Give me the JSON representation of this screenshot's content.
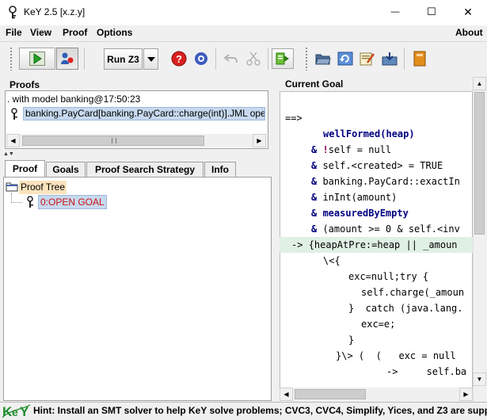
{
  "window": {
    "title": "KeY 2.5 [x.z.y]",
    "minimize_symbol": "—",
    "maximize_symbol": "☐",
    "close_symbol": "✕"
  },
  "menu": {
    "items": [
      "File",
      "View",
      "Proof",
      "Options"
    ],
    "right_item": "About"
  },
  "toolbar": {
    "run_label": "Run Z3",
    "icons": [
      "auto-mode-start-icon",
      "user-interaction-icon",
      "run-z3-button",
      "dropdown-arrow-icon",
      "stop-icon",
      "settings-icon",
      "undo-icon",
      "prune-icon",
      "goal-back-icon",
      "open-folder-icon",
      "reload-icon",
      "edit-icon",
      "save-icon",
      "book-icon"
    ]
  },
  "proofs": {
    "title": "Proofs",
    "env_line": ". with model banking@17:50:23",
    "proof_item": "banking.PayCard[banking.PayCard::charge(int)].JML ope"
  },
  "tabs": [
    "Proof",
    "Goals",
    "Proof Search Strategy",
    "Info"
  ],
  "tree": {
    "root": "Proof Tree",
    "node": "0:OPEN GOAL"
  },
  "goal": {
    "title": "Current Goal",
    "lines": [
      {
        "prefix": "==>",
        "kw": "",
        "body": ""
      },
      {
        "prefix": "",
        "kw": "",
        "body": "wellFormed(heap)"
      },
      {
        "prefix": "& ",
        "kw": "!",
        "body": "self = null"
      },
      {
        "prefix": "& ",
        "kw": "",
        "body": "self.<created> = TRUE"
      },
      {
        "prefix": "& ",
        "kw": "",
        "body": "banking.PayCard::exactIn"
      },
      {
        "prefix": "& ",
        "kw": "",
        "body": "inInt(amount)"
      },
      {
        "prefix": "& ",
        "kw": "",
        "body": "measuredByEmpty"
      },
      {
        "prefix": "& ",
        "kw": "",
        "body": "(amount >= 0 & self.<inv"
      },
      {
        "prefix": "-> ",
        "kw": "",
        "body": "{heapAtPre:=heap || _amoun"
      },
      {
        "prefix": "",
        "kw": "",
        "body": "\\<{"
      },
      {
        "prefix": "",
        "kw": "",
        "body": "exc=null;try {"
      },
      {
        "prefix": "",
        "kw": "",
        "body": "self.charge(_amoun"
      },
      {
        "prefix": "",
        "kw": "",
        "body": "}  catch (java.lang."
      },
      {
        "prefix": "",
        "kw": "",
        "body": "exc=e;"
      },
      {
        "prefix": "",
        "kw": "",
        "body": "}"
      },
      {
        "prefix": "",
        "kw": "",
        "body": "}\\> (  (   exc = null"
      },
      {
        "prefix": "",
        "kw": "",
        "body": "->     self.ba"
      }
    ]
  },
  "status": {
    "hint": "Hint: Install an SMT solver to help KeY solve problems; CVC3, CVC4, Simplify, Yices, and Z3 are suppor"
  }
}
